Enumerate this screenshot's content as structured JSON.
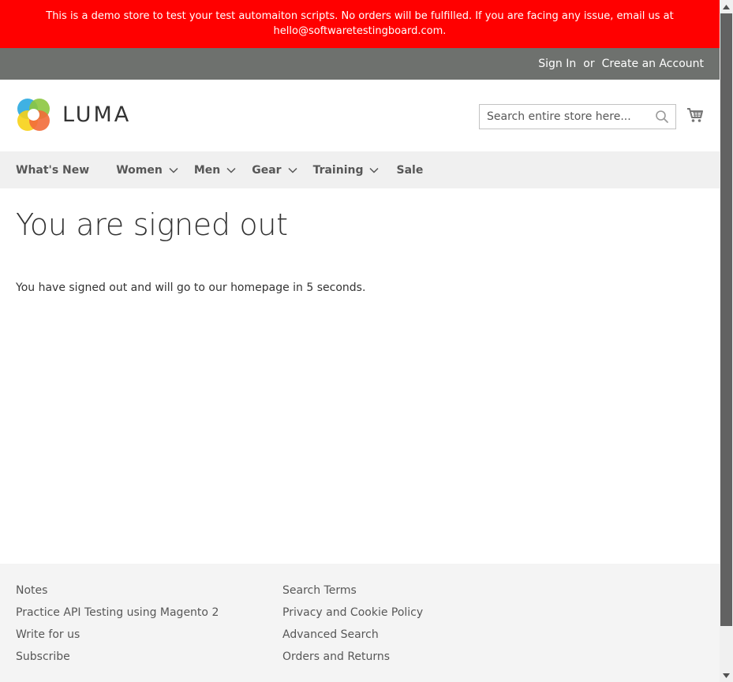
{
  "banner": {
    "line1": "This is a demo store to test your test automaiton scripts. No orders will be fulfilled. If you are facing any issue, email us at",
    "line2": "hello@softwaretestingboard.com."
  },
  "header_links": {
    "sign_in": "Sign In",
    "or": "or",
    "create_account": "Create an Account"
  },
  "logo": {
    "text": "LUMA"
  },
  "search": {
    "placeholder": "Search entire store here..."
  },
  "nav": {
    "items": [
      {
        "label": "What's New",
        "has_dropdown": false
      },
      {
        "label": "Women",
        "has_dropdown": true
      },
      {
        "label": "Men",
        "has_dropdown": true
      },
      {
        "label": "Gear",
        "has_dropdown": true
      },
      {
        "label": "Training",
        "has_dropdown": true
      },
      {
        "label": "Sale",
        "has_dropdown": false
      }
    ]
  },
  "main": {
    "title": "You are signed out",
    "message": "You have signed out and will go to our homepage in 5 seconds."
  },
  "footer": {
    "col1": [
      "Notes",
      "Practice API Testing using Magento 2",
      "Write for us",
      "Subscribe"
    ],
    "col2": [
      "Search Terms",
      "Privacy and Cookie Policy",
      "Advanced Search",
      "Orders and Returns"
    ]
  },
  "colors": {
    "banner_bg": "#ff0000",
    "panel_bg": "#6e716e",
    "nav_bg": "#f0f0f0",
    "footer_bg": "#f4f4f4"
  },
  "icons": {
    "search": "search-icon",
    "cart": "cart-icon",
    "dropdown": "chevron-down-icon"
  }
}
